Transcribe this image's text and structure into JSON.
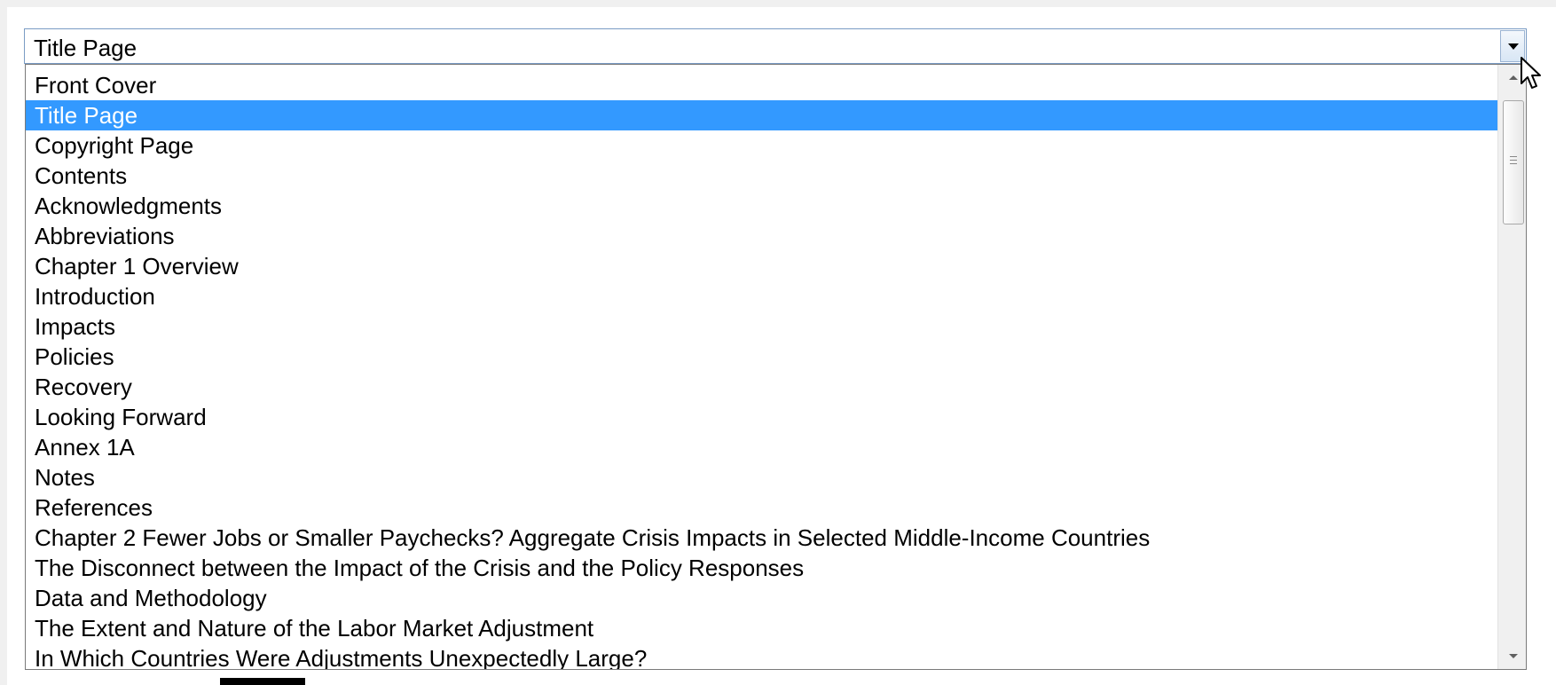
{
  "select": {
    "value": "Title Page",
    "selected_index": 1
  },
  "options": [
    "Front Cover",
    "Title Page",
    "Copyright Page",
    "Contents",
    "Acknowledgments",
    "Abbreviations",
    "Chapter 1 Overview",
    "Introduction",
    "Impacts",
    "Policies",
    "Recovery",
    "Looking Forward",
    "Annex 1A",
    "Notes",
    "References",
    "Chapter 2 Fewer Jobs or Smaller Paychecks? Aggregate Crisis Impacts in Selected Middle-Income Countries",
    "The Disconnect between the Impact of the Crisis and the Policy Responses",
    "Data and Methodology",
    "The Extent and Nature of the Labor Market Adjustment",
    "In Which Countries Were Adjustments Unexpectedly Large?"
  ],
  "icons": {
    "dropdown": "chevron-down-icon",
    "scroll_up": "arrow-up-icon",
    "scroll_down": "arrow-down-icon",
    "cursor": "mouse-pointer-icon"
  },
  "colors": {
    "selection": "#3399ff",
    "selection_text": "#ffffff",
    "border": "#7a9cc4"
  }
}
